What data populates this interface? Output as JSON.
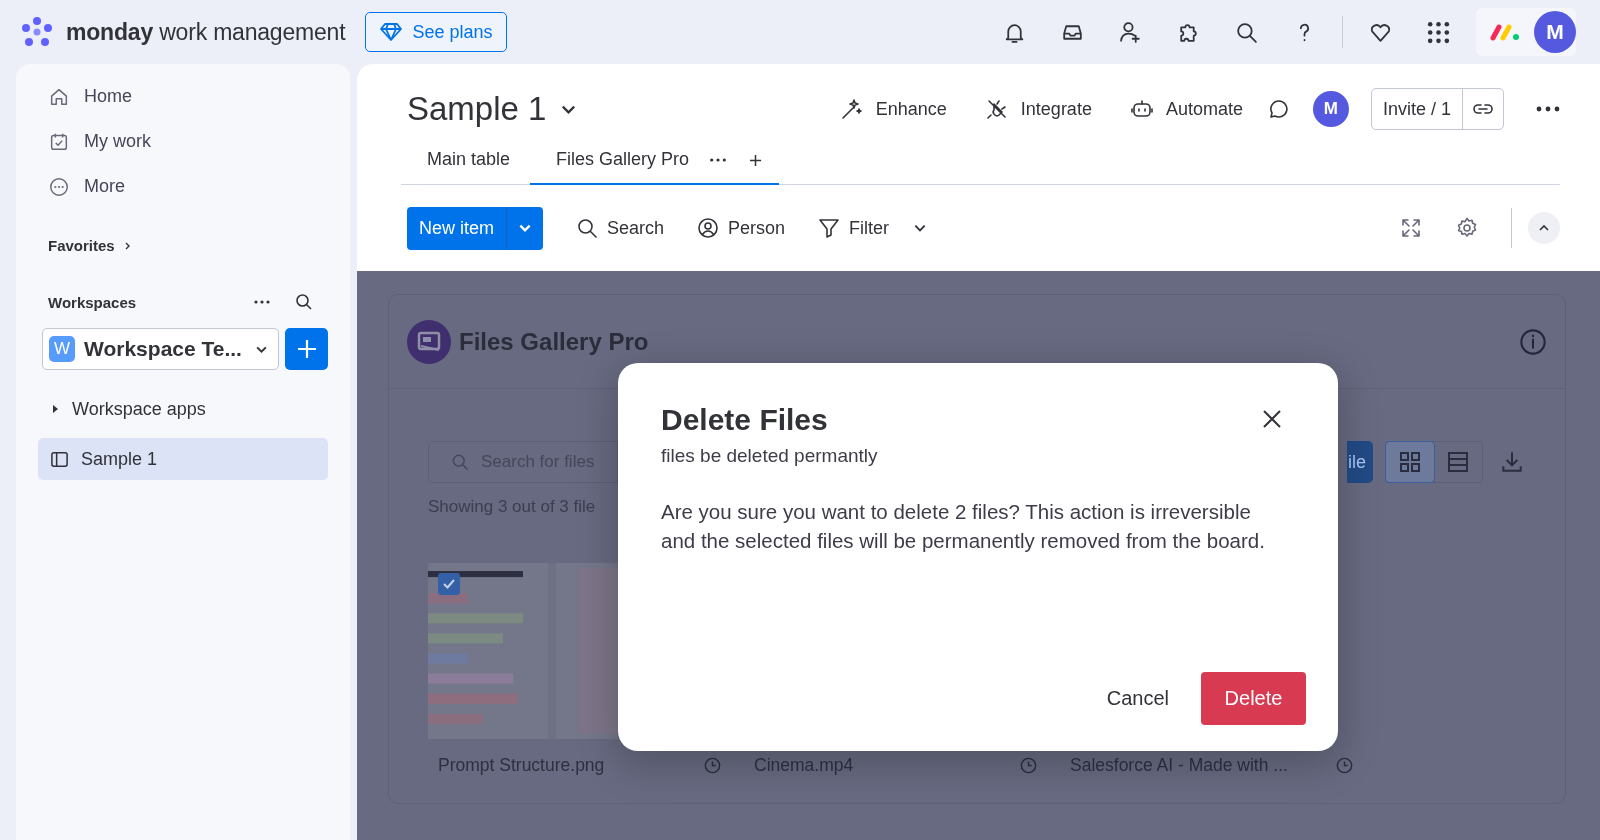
{
  "topbar": {
    "brand_bold": "monday",
    "brand_rest": "work management",
    "see_plans": "See plans",
    "avatar": "M"
  },
  "sidebar": {
    "nav": [
      "Home",
      "My work",
      "More"
    ],
    "favorites": "Favorites",
    "workspaces_title": "Workspaces",
    "workspace": {
      "badge": "W",
      "name": "Workspace Te..."
    },
    "tree": [
      {
        "kind": "folder",
        "label": "Workspace apps",
        "selected": false
      },
      {
        "kind": "board",
        "label": "Sample 1",
        "selected": true
      }
    ]
  },
  "board": {
    "title": "Sample 1",
    "actions": [
      "Enhance",
      "Integrate",
      "Automate"
    ],
    "avatar": "M",
    "invite": "Invite / 1",
    "tabs": [
      {
        "label": "Main table",
        "selected": false
      },
      {
        "label": "Files Gallery Pro",
        "selected": true
      }
    ],
    "toolbar": {
      "new_item": "New item",
      "search": "Search",
      "person": "Person",
      "filter": "Filter"
    }
  },
  "gallery": {
    "title": "Files Gallery Pro",
    "search_placeholder": "Search for files",
    "showing": "Showing 3 out of 3 file",
    "upload": "ile",
    "view_modes": [
      {
        "kind": "grid",
        "selected": true
      },
      {
        "kind": "list",
        "selected": false
      }
    ],
    "files": [
      {
        "name": "Prompt Structure.png",
        "thumbnail": {
          "checked": true
        }
      },
      {
        "name": "Cinema.mp4"
      },
      {
        "name": "Salesforce AI - Made with ..."
      }
    ]
  },
  "dialog": {
    "title": "Delete Files",
    "subtitle": "files be deleted permantly",
    "body": "Are you sure you want to delete 2 files? This action is irreversible and the selected files will be permanently removed from the board.",
    "cancel": "Cancel",
    "confirm": "Delete"
  }
}
